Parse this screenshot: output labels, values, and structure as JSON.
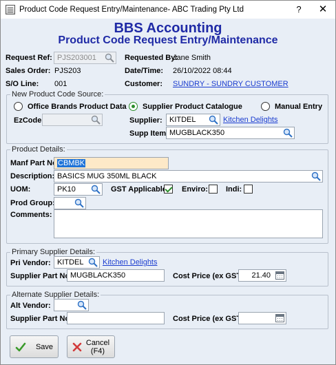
{
  "window": {
    "title": "Product Code Request Entry/Maintenance- ABC Trading Pty Ltd",
    "help_btn": "?",
    "close_btn": "✕"
  },
  "header": {
    "app": "BBS Accounting",
    "subtitle": "Product Code Request Entry/Maintenance"
  },
  "request": {
    "ref_label": "Request Ref:",
    "ref_value": "PJS203001",
    "requested_by_label": "Requested By:",
    "requested_by_value": "Jane Smith",
    "sales_order_label": "Sales Order:",
    "sales_order_value": "PJS203",
    "datetime_label": "Date/Time:",
    "datetime_value": "26/10/2022 08:44",
    "so_line_label": "S/O Line:",
    "so_line_value": "001",
    "customer_label": "Customer:",
    "customer_value": "SUNDRY - SUNDRY CUSTOMER"
  },
  "source": {
    "group_title": "New Product Code Source:",
    "radios": [
      {
        "label": "Office Brands Product Data",
        "selected": false
      },
      {
        "label": "Supplier Product Catalogue",
        "selected": true
      },
      {
        "label": "Manual Entry",
        "selected": false
      }
    ],
    "ezcode_label": "EzCode:",
    "ezcode_value": "",
    "supplier_label": "Supplier:",
    "supplier_value": "KITDEL",
    "supplier_name": "Kitchen Delights",
    "supp_item_label": "Supp Item:",
    "supp_item_value": "MUGBLACK350"
  },
  "product": {
    "group_title": "Product Details:",
    "manf_label": "Manf Part No:",
    "manf_value": "CBMBK",
    "desc_label": "Description:",
    "desc_value": "BASICS MUG 350ML BLACK",
    "uom_label": "UOM:",
    "uom_value": "PK10",
    "gst_label": "GST Applicable:",
    "gst_checked": true,
    "enviro_label": "Enviro:",
    "enviro_checked": false,
    "indi_label": "Indi:",
    "indi_checked": false,
    "prod_group_label": "Prod Group:",
    "prod_group_value": "",
    "comments_label": "Comments:",
    "comments_value": ""
  },
  "primary": {
    "group_title": "Primary Supplier Details:",
    "vendor_label": "Pri Vendor:",
    "vendor_value": "KITDEL",
    "vendor_name": "Kitchen Delights",
    "part_label": "Supplier Part No:",
    "part_value": "MUGBLACK350",
    "cost_label": "Cost Price (ex GST):",
    "cost_value": "21.40"
  },
  "alternate": {
    "group_title": "Alternate Supplier Details:",
    "vendor_label": "Alt Vendor:",
    "vendor_value": "",
    "part_label": "Supplier Part No:",
    "part_value": "",
    "cost_label": "Cost Price (ex GST):",
    "cost_value": ""
  },
  "buttons": {
    "save": "Save",
    "cancel_line1": "Cancel",
    "cancel_line2": "(F4)"
  },
  "colors": {
    "heading": "#1f2aa6",
    "link": "#1a3ccf",
    "background": "#e8eef6",
    "selected_green": "#2a8c2a"
  }
}
